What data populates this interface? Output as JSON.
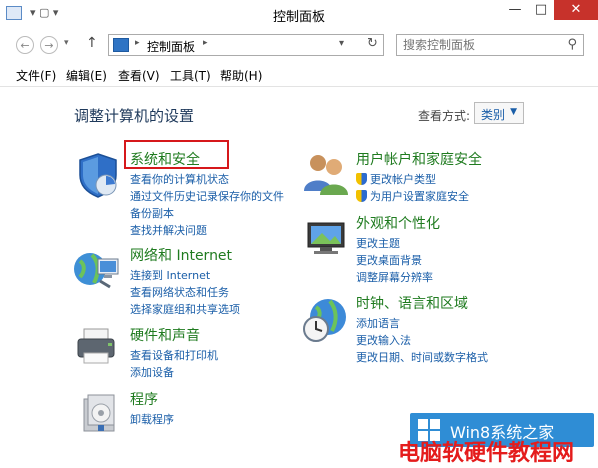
{
  "window": {
    "title": "控制面板",
    "controls": {
      "minimize": "—",
      "maximize": "□",
      "close": "✕"
    }
  },
  "address": {
    "back": "←",
    "forward": "→",
    "up": "↑",
    "path": "控制面板",
    "search_placeholder": "搜索控制面板"
  },
  "menu": [
    "文件(F)",
    "编辑(E)",
    "查看(V)",
    "工具(T)",
    "帮助(H)"
  ],
  "header": {
    "title": "调整计算机的设置",
    "view_by_label": "查看方式:",
    "view_by_value": "类别"
  },
  "categories": {
    "system_security": {
      "title": "系统和安全",
      "links": [
        "查看你的计算机状态",
        "通过文件历史记录保存你的文件",
        "备份副本",
        "查找并解决问题"
      ]
    },
    "network": {
      "title": "网络和 Internet",
      "links": [
        "连接到 Internet",
        "查看网络状态和任务",
        "选择家庭组和共享选项"
      ]
    },
    "hardware": {
      "title": "硬件和声音",
      "links": [
        "查看设备和打印机",
        "添加设备"
      ]
    },
    "programs": {
      "title": "程序",
      "links": [
        "卸载程序"
      ]
    },
    "user_accounts": {
      "title": "用户帐户和家庭安全",
      "links": [
        "更改帐户类型",
        "为用户设置家庭安全"
      ]
    },
    "appearance": {
      "title": "外观和个性化",
      "links": [
        "更改主题",
        "更改桌面背景",
        "调整屏幕分辨率"
      ]
    },
    "clock": {
      "title": "时钟、语言和区域",
      "links": [
        "添加语言",
        "更改输入法",
        "更改日期、时间或数字格式"
      ]
    }
  },
  "watermark": {
    "logo_text": "Win8系统之家",
    "site_text": "电脑软硬件教程网"
  },
  "colors": {
    "category_title": "#1f7b1f",
    "link": "#1a5ea8",
    "highlight_box": "#d6181b",
    "close_button": "#c7322b"
  }
}
